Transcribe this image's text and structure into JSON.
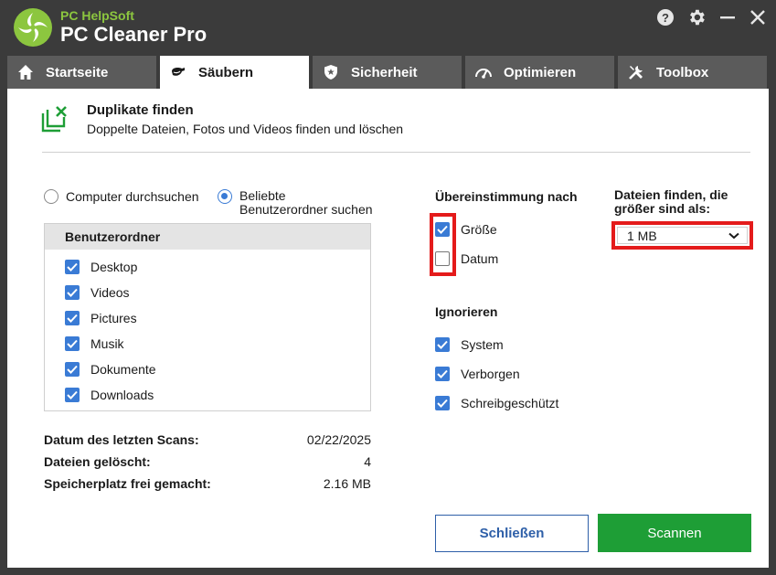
{
  "app": {
    "brand_small": "PC HelpSoft",
    "brand_name": "PC Cleaner Pro"
  },
  "colors": {
    "accent_green": "#1e9e36",
    "accent_blue": "#3a7bd5",
    "highlight_red": "#e41b1b",
    "titlebar": "#3b3b3b"
  },
  "tabs": [
    {
      "label": "Startseite",
      "icon": "home-icon"
    },
    {
      "label": "Säubern",
      "icon": "broom-icon"
    },
    {
      "label": "Sicherheit",
      "icon": "shield-icon"
    },
    {
      "label": "Optimieren",
      "icon": "speedometer-icon"
    },
    {
      "label": "Toolbox",
      "icon": "tools-icon"
    }
  ],
  "header": {
    "title": "Duplikate finden",
    "subtitle": "Doppelte Dateien, Fotos und Videos finden und löschen"
  },
  "search_mode": {
    "option_computer": "Computer durchsuchen",
    "option_folders_line1": "Beliebte",
    "option_folders_line2": "Benutzerordner suchen",
    "selected": "folders"
  },
  "folders": {
    "header": "Benutzerordner",
    "items": [
      {
        "label": "Desktop",
        "checked": true
      },
      {
        "label": "Videos",
        "checked": true
      },
      {
        "label": "Pictures",
        "checked": true
      },
      {
        "label": "Musik",
        "checked": true
      },
      {
        "label": "Dokumente",
        "checked": true
      },
      {
        "label": "Downloads",
        "checked": true
      }
    ]
  },
  "stats": [
    {
      "label": "Datum des letzten Scans:",
      "value": "02/22/2025"
    },
    {
      "label": "Dateien gelöscht:",
      "value": "4"
    },
    {
      "label": "Speicherplatz frei gemacht:",
      "value": "2.16 MB"
    }
  ],
  "match": {
    "label": "Übereinstimmung nach",
    "options": [
      {
        "label": "Größe",
        "checked": true
      },
      {
        "label": "Datum",
        "checked": false
      }
    ]
  },
  "ignore": {
    "label": "Ignorieren",
    "options": [
      {
        "label": "System",
        "checked": true
      },
      {
        "label": "Verborgen",
        "checked": true
      },
      {
        "label": "Schreibgeschützt",
        "checked": true
      }
    ]
  },
  "min_size": {
    "label_line1": "Dateien finden, die",
    "label_line2": "größer sind als:",
    "value": "1 MB"
  },
  "buttons": {
    "close": "Schließen",
    "scan": "Scannen"
  }
}
